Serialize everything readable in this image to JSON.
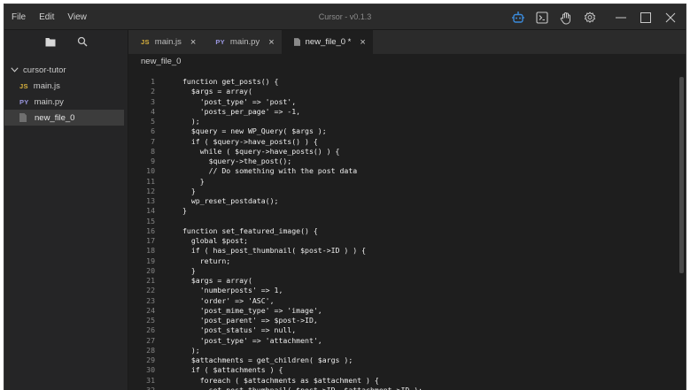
{
  "menu": [
    "File",
    "Edit",
    "View"
  ],
  "window": {
    "title": "Cursor - v0.1.3"
  },
  "toolbar_icons": [
    "bot-icon",
    "terminal-icon",
    "hand-icon",
    "gear-icon"
  ],
  "sidebar": {
    "root_label": "cursor-tutor",
    "files": [
      {
        "ext": "JS",
        "name": "main.js",
        "ext_color": "#d9b23d"
      },
      {
        "ext": "PY",
        "name": "main.py",
        "ext_color": "#9a97e0"
      },
      {
        "ext": "",
        "name": "new_file_0",
        "selected": true
      }
    ]
  },
  "tabs": [
    {
      "ext": "JS",
      "label": "main.js",
      "close": "×"
    },
    {
      "ext": "PY",
      "label": "main.py",
      "close": "×"
    },
    {
      "ext": "",
      "label": "new_file_0 *",
      "close": "×",
      "active": true
    }
  ],
  "breadcrumb": "new_file_0",
  "code_lines": [
    "function get_posts() {",
    "  $args = array(",
    "    'post_type' => 'post',",
    "    'posts_per_page' => -1,",
    "  );",
    "  $query = new WP_Query( $args );",
    "  if ( $query->have_posts() ) {",
    "    while ( $query->have_posts() ) {",
    "      $query->the_post();",
    "      // Do something with the post data",
    "    }",
    "  }",
    "  wp_reset_postdata();",
    "}",
    "",
    "function set_featured_image() {",
    "  global $post;",
    "  if ( has_post_thumbnail( $post->ID ) ) {",
    "    return;",
    "  }",
    "  $args = array(",
    "    'numberposts' => 1,",
    "    'order' => 'ASC',",
    "    'post_mime_type' => 'image',",
    "    'post_parent' => $post->ID,",
    "    'post_status' => null,",
    "    'post_type' => 'attachment',",
    "  );",
    "  $attachments = get_children( $args );",
    "  if ( $attachments ) {",
    "    foreach ( $attachments as $attachment ) {",
    "      set_post_thumbnail( $post->ID, $attachment->ID );"
  ]
}
